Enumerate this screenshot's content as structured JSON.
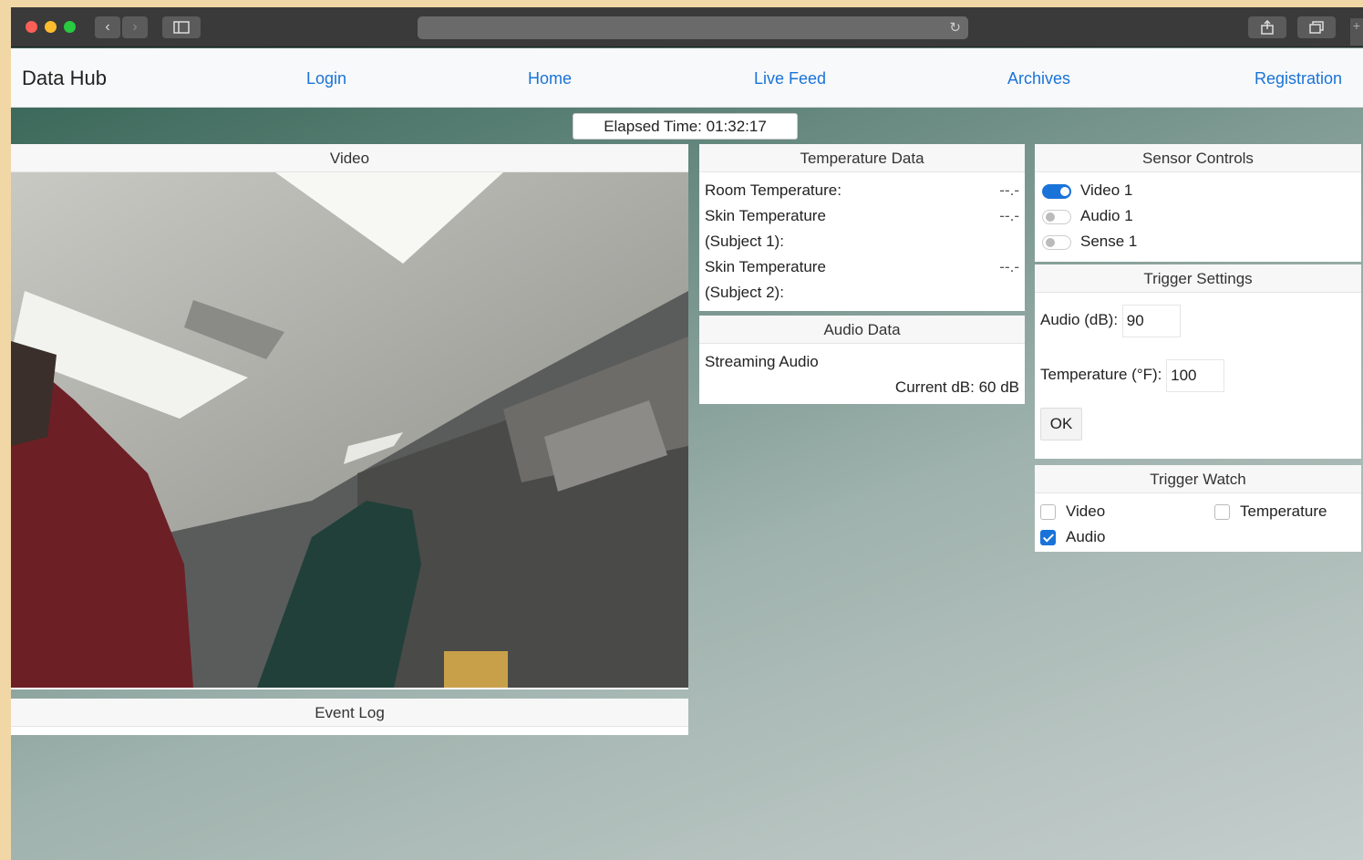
{
  "browser": {
    "reload_glyph": "↻",
    "back_glyph": "‹",
    "forward_glyph": "›"
  },
  "nav": {
    "brand": "Data Hub",
    "links": [
      "Login",
      "Home",
      "Live Feed",
      "Archives",
      "Registration"
    ]
  },
  "elapsed": "Elapsed Time: 01:32:17",
  "video": {
    "title": "Video"
  },
  "event_log": {
    "title": "Event Log"
  },
  "temperature": {
    "title": "Temperature Data",
    "rows": [
      {
        "label": "Room Temperature:",
        "value": "--.-"
      },
      {
        "label": "Skin Temperature",
        "value": "--.-"
      },
      {
        "label": "(Subject 1):",
        "value": ""
      },
      {
        "label": "Skin Temperature",
        "value": "--.-"
      },
      {
        "label": "(Subject 2):",
        "value": ""
      }
    ]
  },
  "audio": {
    "title": "Audio Data",
    "status": "Streaming Audio",
    "current_db": "Current dB: 60 dB"
  },
  "sensor_controls": {
    "title": "Sensor Controls",
    "items": [
      {
        "label": "Video 1",
        "on": true
      },
      {
        "label": "Audio 1",
        "on": false
      },
      {
        "label": "Sense 1",
        "on": false
      }
    ]
  },
  "trigger_settings": {
    "title": "Trigger Settings",
    "audio_label": "Audio (dB):",
    "audio_value": "90",
    "temp_label": "Temperature (°F):",
    "temp_value": "100",
    "ok_label": "OK"
  },
  "trigger_watch": {
    "title": "Trigger Watch",
    "video_label": "Video",
    "video_checked": false,
    "temperature_label": "Temperature",
    "temperature_checked": false,
    "audio_label": "Audio",
    "audio_checked": true
  },
  "colors": {
    "accent": "#1a73d8",
    "background_gradient_start": "#2e5f4f",
    "background_gradient_end": "#c4cecd"
  }
}
